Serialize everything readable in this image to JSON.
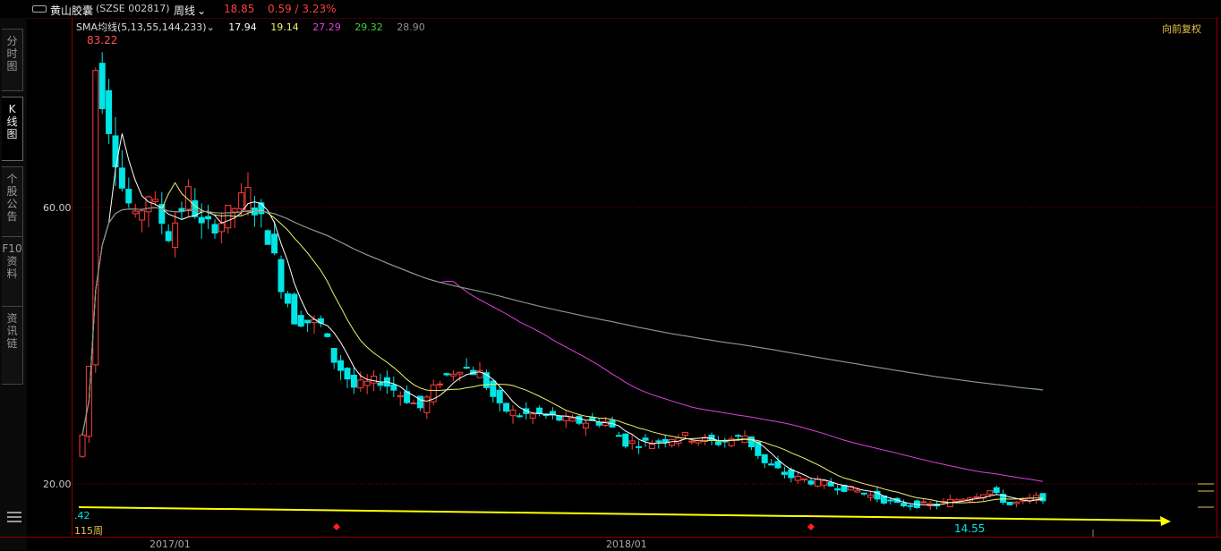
{
  "titlebar": {
    "icon": "window-toggle-icon",
    "stock_name": "黄山胶囊",
    "stock_code": "(SZSE 002817)",
    "period": "周线",
    "price": "18.85",
    "change": "0.59 / 3.23%"
  },
  "side_tabs": [
    {
      "label": "分时图",
      "active": false
    },
    {
      "label": "K线图",
      "active": true
    },
    {
      "label": "个股公告",
      "active": false
    },
    {
      "label": "F10资料",
      "active": false
    },
    {
      "label": "资讯链",
      "active": false
    }
  ],
  "ma_header": {
    "label": "SMA均线(5,13,55,144,233)",
    "values": [
      "17.94",
      "19.14",
      "27.29",
      "29.32",
      "28.90"
    ],
    "colors": [
      "#ffffff",
      "#f2f26e",
      "#e040e0",
      "#40d040",
      "#909090"
    ]
  },
  "restore_label": "向前复权",
  "price_labels": {
    "y60": "60.00",
    "y20": "20.00",
    "high": "83.22",
    "low": "14.55",
    "left_cut": ".42",
    "period_count": "115周"
  },
  "date_labels": [
    "2017/01",
    "2018/01"
  ],
  "chart_data": {
    "type": "candlestick",
    "y_ticks": [
      20,
      60
    ],
    "high_marker": 83.22,
    "low_marker": 14.55,
    "colors": {
      "up": "#ff3c3c",
      "down": "#00e5e5",
      "ma5": "#ffffff",
      "ma13": "#f2f26e",
      "ma55": "#e040e0",
      "ma144": "#40d040",
      "ma233": "#909090",
      "trend": "#ffff00"
    }
  }
}
